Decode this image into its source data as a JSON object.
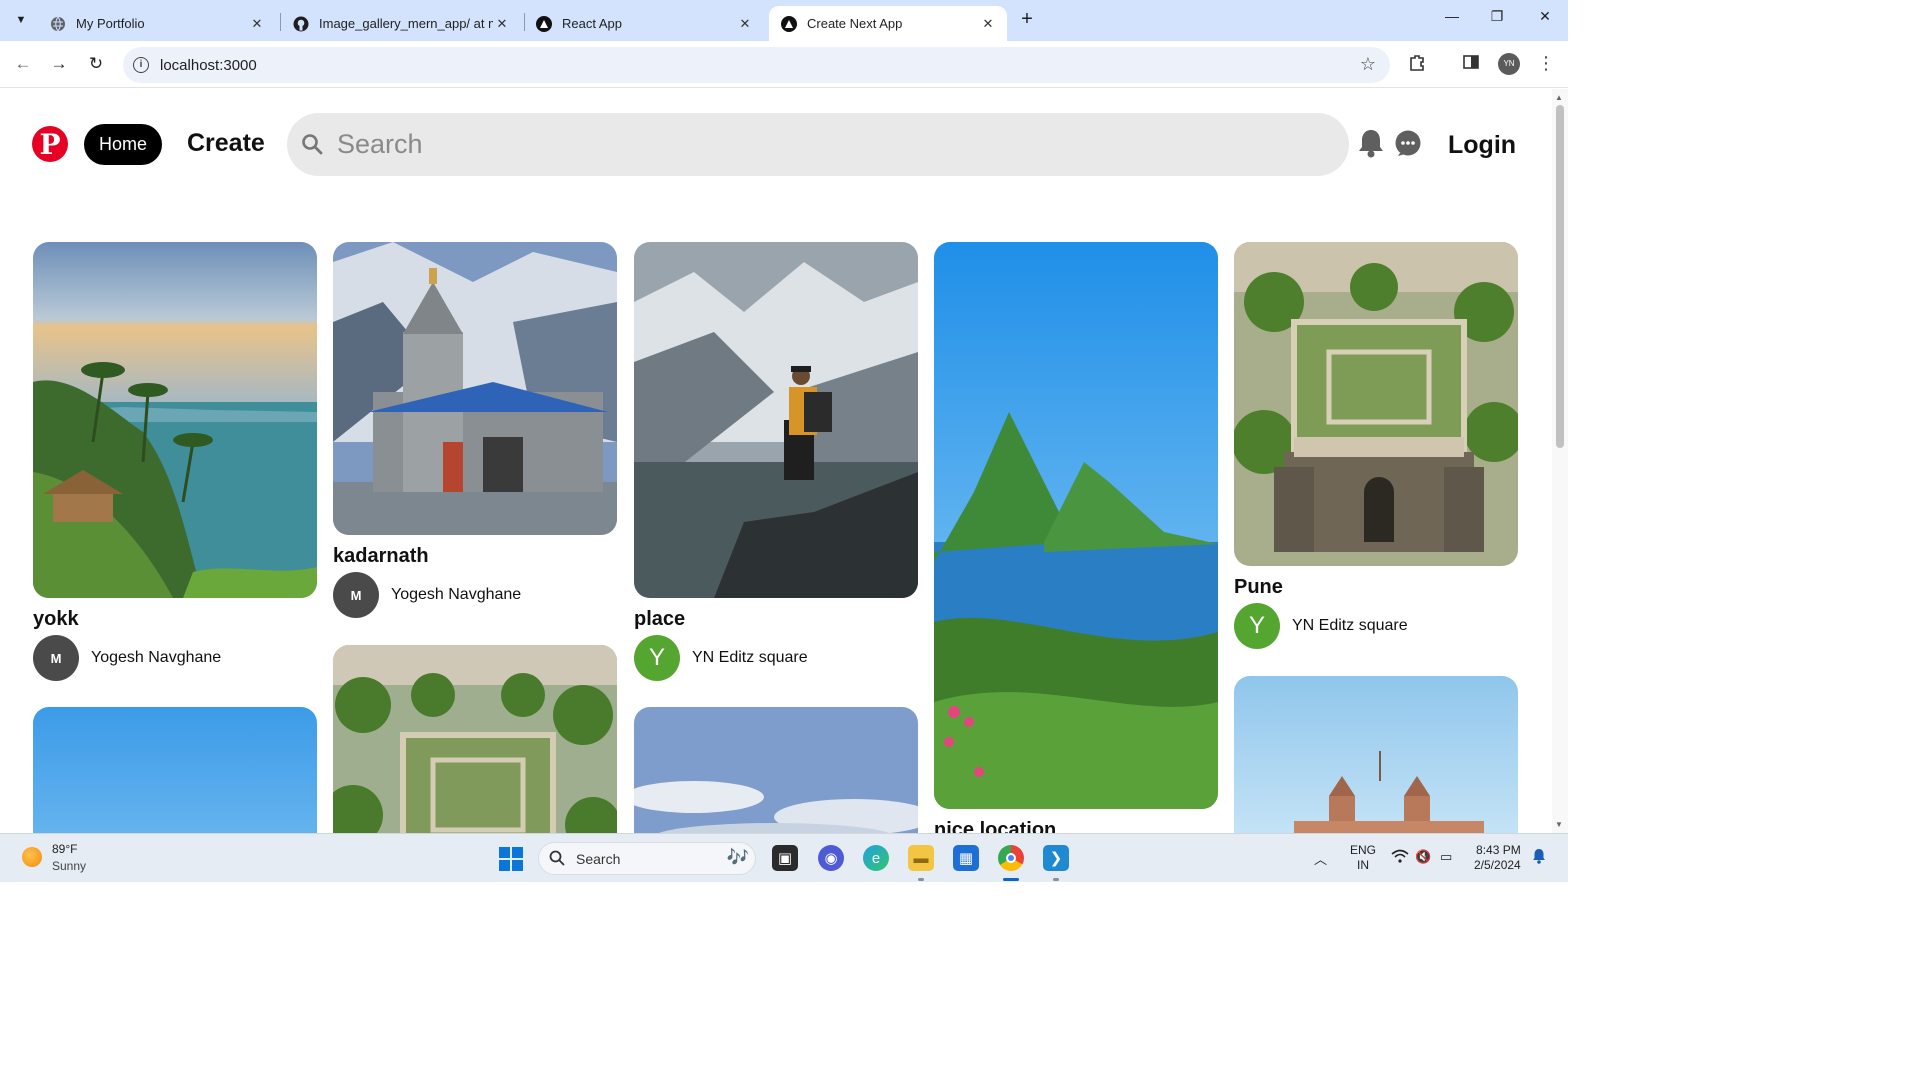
{
  "browser": {
    "tabs": [
      {
        "title": "My Portfolio",
        "icon": "globe-icon"
      },
      {
        "title": "Image_gallery_mern_app/ at ma",
        "icon": "github-icon"
      },
      {
        "title": "React App",
        "icon": "triangle-icon"
      },
      {
        "title": "Create Next App",
        "icon": "triangle-icon",
        "active": true
      }
    ],
    "url": "localhost:3000"
  },
  "header": {
    "logo_letter": "P",
    "home_label": "Home",
    "create_label": "Create",
    "search_placeholder": "Search",
    "login_label": "Login"
  },
  "pins": [
    {
      "title": "yokk",
      "author": "Yogesh Navghane",
      "avatar_type": "logo",
      "scene": "coast"
    },
    {
      "title": "kadarnath",
      "author": "Yogesh Navghane",
      "avatar_type": "logo",
      "scene": "temple"
    },
    {
      "title": "place",
      "author": "YN Editz square",
      "avatar_type": "letter",
      "avatar_letter": "Y",
      "scene": "hiker"
    },
    {
      "title": "nice location",
      "author": "",
      "avatar_type": "",
      "scene": "peaks"
    },
    {
      "title": "Pune",
      "author": "YN Editz square",
      "avatar_type": "letter",
      "avatar_letter": "Y",
      "scene": "fort"
    },
    {
      "title": "",
      "author": "",
      "scene": "sky"
    },
    {
      "title": "",
      "author": "",
      "scene": "fort"
    },
    {
      "title": "",
      "author": "",
      "scene": "clouds"
    },
    {
      "title": "",
      "author": "",
      "scene": "gateway"
    }
  ],
  "taskbar": {
    "weather_temp": "89°F",
    "weather_condition": "Sunny",
    "search_label": "Search",
    "language": "ENG",
    "region": "IN",
    "time": "8:43 PM",
    "date": "2/5/2024"
  },
  "colors": {
    "brand": "#e60023",
    "avatar_green": "#55a630",
    "chrome_tab_bar": "#d3e3fd"
  }
}
